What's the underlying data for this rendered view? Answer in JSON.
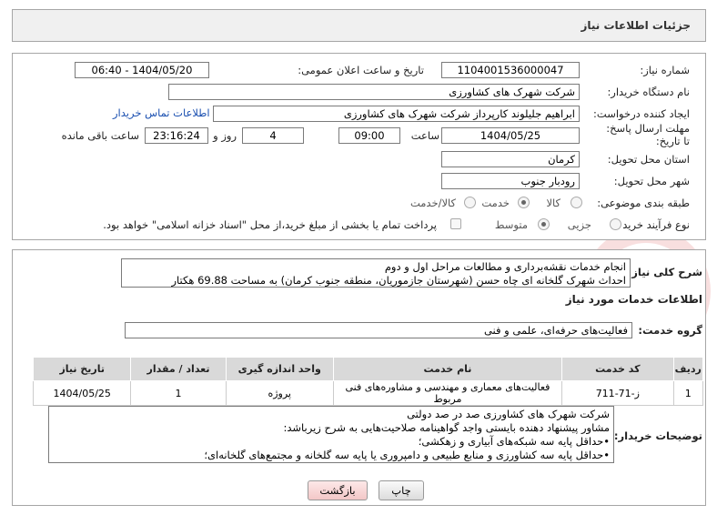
{
  "header": {
    "title": "جزئیات اطلاعات نیاز"
  },
  "form": {
    "need_number_label": "شماره نیاز:",
    "need_number": "1104001536000047",
    "announce_label": "تاریخ و ساعت اعلان عمومی:",
    "announce_value": "1404/05/20 - 06:40",
    "buyer_org_label": "نام دستگاه خریدار:",
    "buyer_org": "شرکت شهرک های کشاورزی",
    "creator_label": "ایجاد کننده درخواست:",
    "creator": "ابراهیم جلیلوند کارپرداز شرکت شهرک های کشاورزی",
    "contact_link": "اطلاعات تماس خریدار",
    "deadline_label": "مهلت ارسال پاسخ: تا تاریخ:",
    "deadline_date": "1404/05/25",
    "time_label": "ساعت",
    "deadline_time": "09:00",
    "days_value": "4",
    "days_label": "روز و",
    "remaining_time": "23:16:24",
    "remaining_label": "ساعت باقی مانده",
    "province_label": "استان محل تحویل:",
    "province": "کرمان",
    "city_label": "شهر محل تحویل:",
    "city": "رودبار جنوب",
    "category_label": "طبقه بندی موضوعی:",
    "category_options": [
      "کالا",
      "خدمت",
      "کالا/خدمت"
    ],
    "category_selected": "خدمت",
    "process_label": "نوع فرآیند خرید :",
    "process_options": [
      "جزیی",
      "متوسط"
    ],
    "process_selected": "متوسط",
    "payment_text": "پرداخت تمام یا بخشی از مبلغ خرید،از محل \"اسناد خزانه اسلامی\" خواهد بود."
  },
  "summary": {
    "label": "شرح کلی نیاز:",
    "line1": "انجام خدمات نقشه‌برداری و مطالعات مراحل اول و دوم",
    "line2": "احداث شهرک گلخانه ای چاه حسن (شهرستان جازموریان، منطقه جنوب کرمان) به مساحت 69.88 هکتار"
  },
  "services": {
    "section_title": "اطلاعات خدمات مورد نیاز",
    "group_label": "گروه خدمت:",
    "group_value": "فعالیت‌های حرفه‌ای، علمی و فنی",
    "columns": [
      "ردیف",
      "کد خدمت",
      "نام خدمت",
      "واحد اندازه گیری",
      "تعداد / مقدار",
      "تاریخ نیاز"
    ],
    "rows": [
      [
        "1",
        "ز-71-711",
        "فعالیت‌های معماری و مهندسی و مشاوره‌های فنی مربوط",
        "پروژه",
        "1",
        "1404/05/25"
      ]
    ]
  },
  "buyer_notes": {
    "label": "توضیحات خریدار:",
    "lines": [
      "شرکت شهرک های کشاورزی صد در صد دولتی",
      "مشاور پیشنهاد دهنده بایستی واجد گواهینامه صلاحیت‌هایی به شرح زیرباشد:",
      "•حداقل پایه سه شبکه‌های آبیاری و زهکشی؛",
      "•حداقل پایه سه کشاورزی و منابع طبیعی و دامپروری یا پایه سه گلخانه و مجتمع‌های گلخانه‌ای؛"
    ]
  },
  "buttons": {
    "print": "چاپ",
    "back": "بازگشت"
  }
}
